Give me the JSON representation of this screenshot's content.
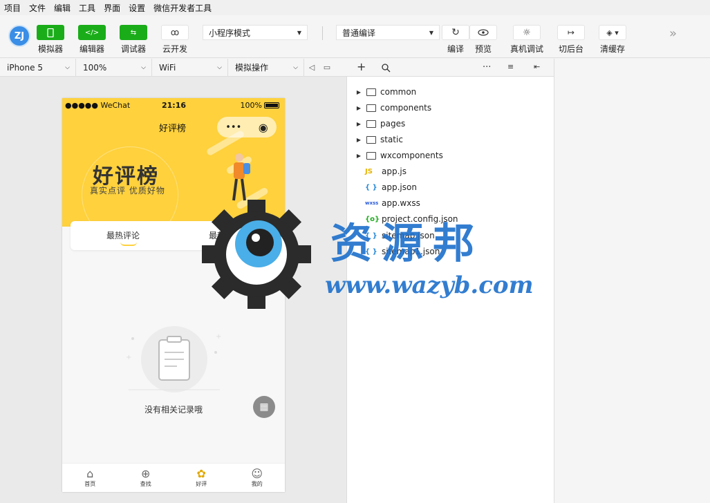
{
  "menu": [
    "项目",
    "文件",
    "编辑",
    "工具",
    "界面",
    "设置",
    "微信开发者工具"
  ],
  "toolbar": {
    "simulator": "模拟器",
    "editor": "编辑器",
    "debugger": "调试器",
    "cloud": "云开发",
    "mode_select": "小程序模式",
    "compile_select": "普通编译",
    "compile": "编译",
    "preview": "预览",
    "real_debug": "真机调试",
    "background": "切后台",
    "clear_cache": "清缓存"
  },
  "device_bar": {
    "device": "iPhone 5",
    "zoom": "100%",
    "network": "WiFi",
    "operation": "模拟操作"
  },
  "phone": {
    "carrier": "●●●●● WeChat",
    "time": "21:16",
    "battery": "100%",
    "nav_title": "好评榜",
    "banner_title": "好评榜",
    "banner_subtitle": "真实点评  优质好物",
    "tab_hot": "最热评论",
    "tab_new": "最新评论",
    "empty_text": "没有相关记录哦",
    "tabbar": [
      {
        "label": "首页",
        "icon": "home-icon"
      },
      {
        "label": "查找",
        "icon": "search-plus-icon"
      },
      {
        "label": "好评",
        "icon": "flower-icon"
      },
      {
        "label": "我的",
        "icon": "smile-icon"
      }
    ]
  },
  "explorer": {
    "folders": [
      "common",
      "components",
      "pages",
      "static",
      "wxcomponents"
    ],
    "files": [
      {
        "name": "app.js",
        "badge": "JS",
        "color": "#e8b400"
      },
      {
        "name": "app.json",
        "badge": "{ }",
        "color": "#2a8bd8"
      },
      {
        "name": "app.wxss",
        "badge": "wxss",
        "color": "#2a5bd8"
      },
      {
        "name": "project.config.json",
        "badge": "{o}",
        "color": "#1aad19"
      },
      {
        "name": "sitemap.json",
        "badge": "{ }",
        "color": "#2a8bd8"
      },
      {
        "name": "sitemap1.json",
        "badge": "{ }",
        "color": "#2a8bd8"
      }
    ]
  },
  "watermark": {
    "cn": "资源邦",
    "url": "www.wazyb.com"
  }
}
